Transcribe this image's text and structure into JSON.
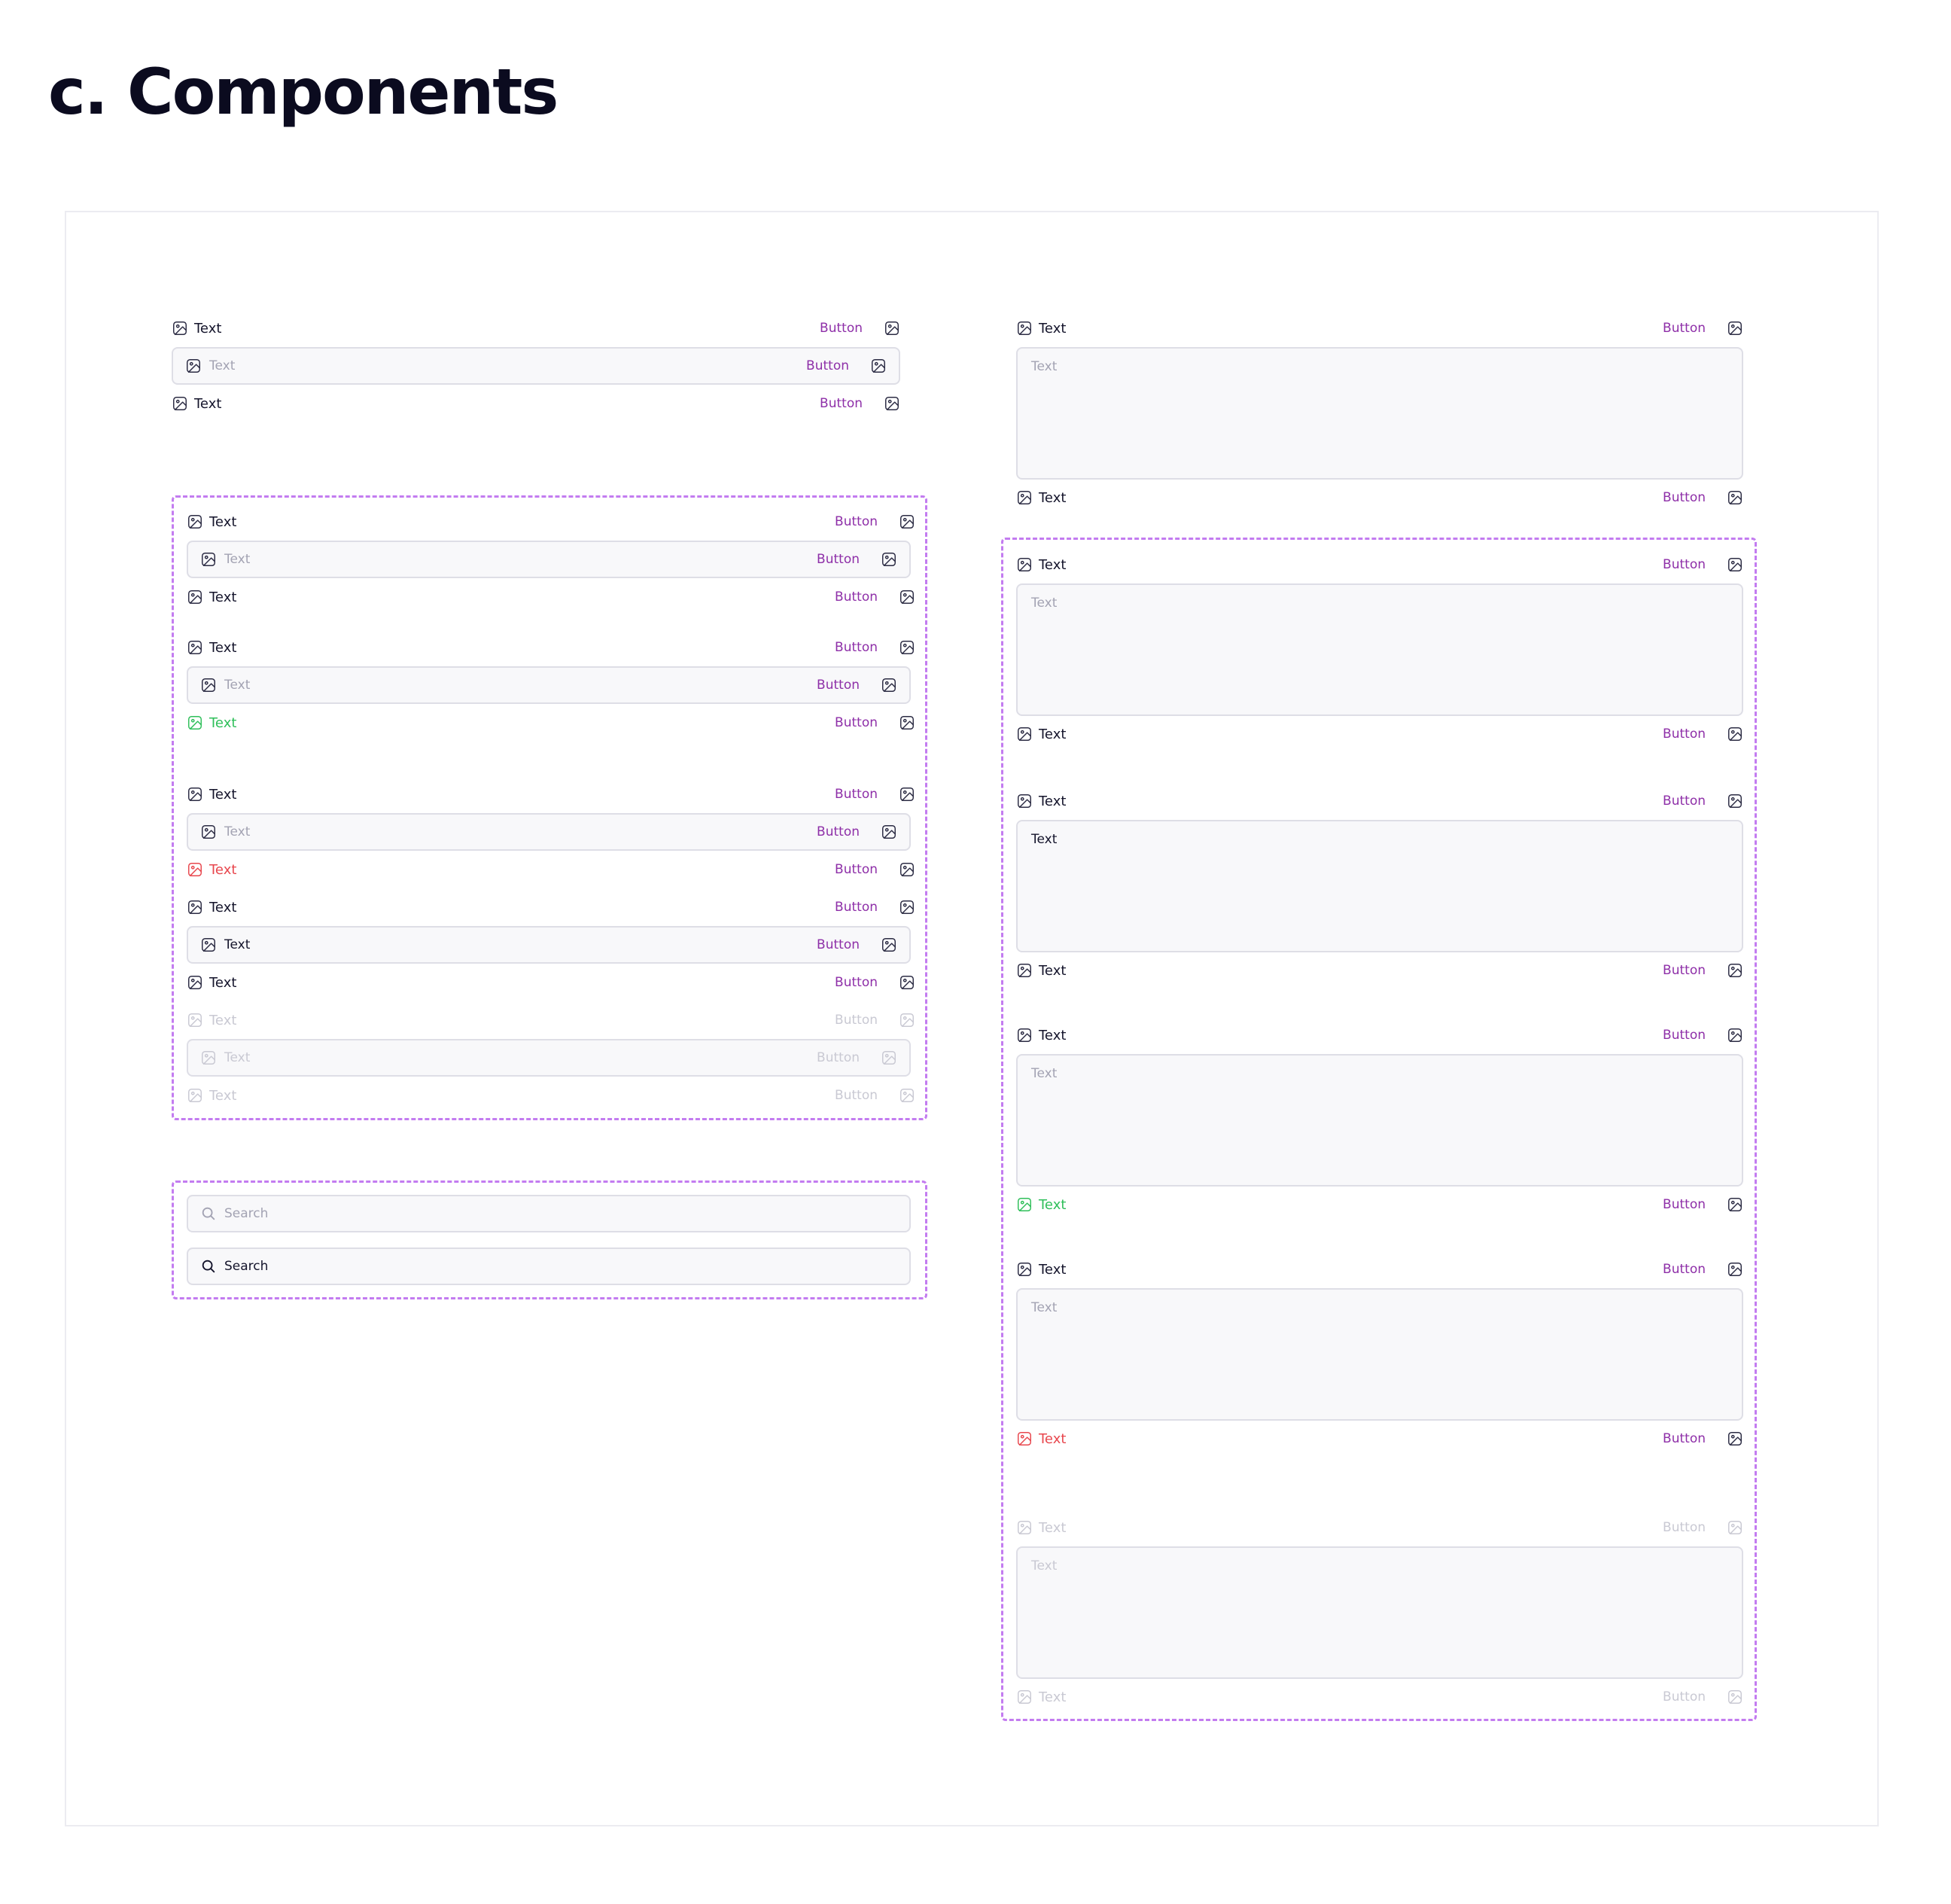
{
  "page": {
    "title": "c. Components"
  },
  "colors": {
    "text": "#14142b",
    "button": "#8e2fa8",
    "placeholder": "#a3a3b3",
    "success": "#2fbf5a",
    "error": "#e8474e",
    "disabled": "#c9c9d3",
    "group_border": "#c37cf0",
    "field_bg": "#f8f8fa"
  },
  "icons": {
    "image": "image-icon",
    "search": "search-icon"
  },
  "label_text": "Text",
  "button_text": "Button",
  "input": {
    "placeholder": "Text",
    "value": "Text"
  },
  "search": {
    "placeholder": "Search",
    "value": "Search"
  }
}
